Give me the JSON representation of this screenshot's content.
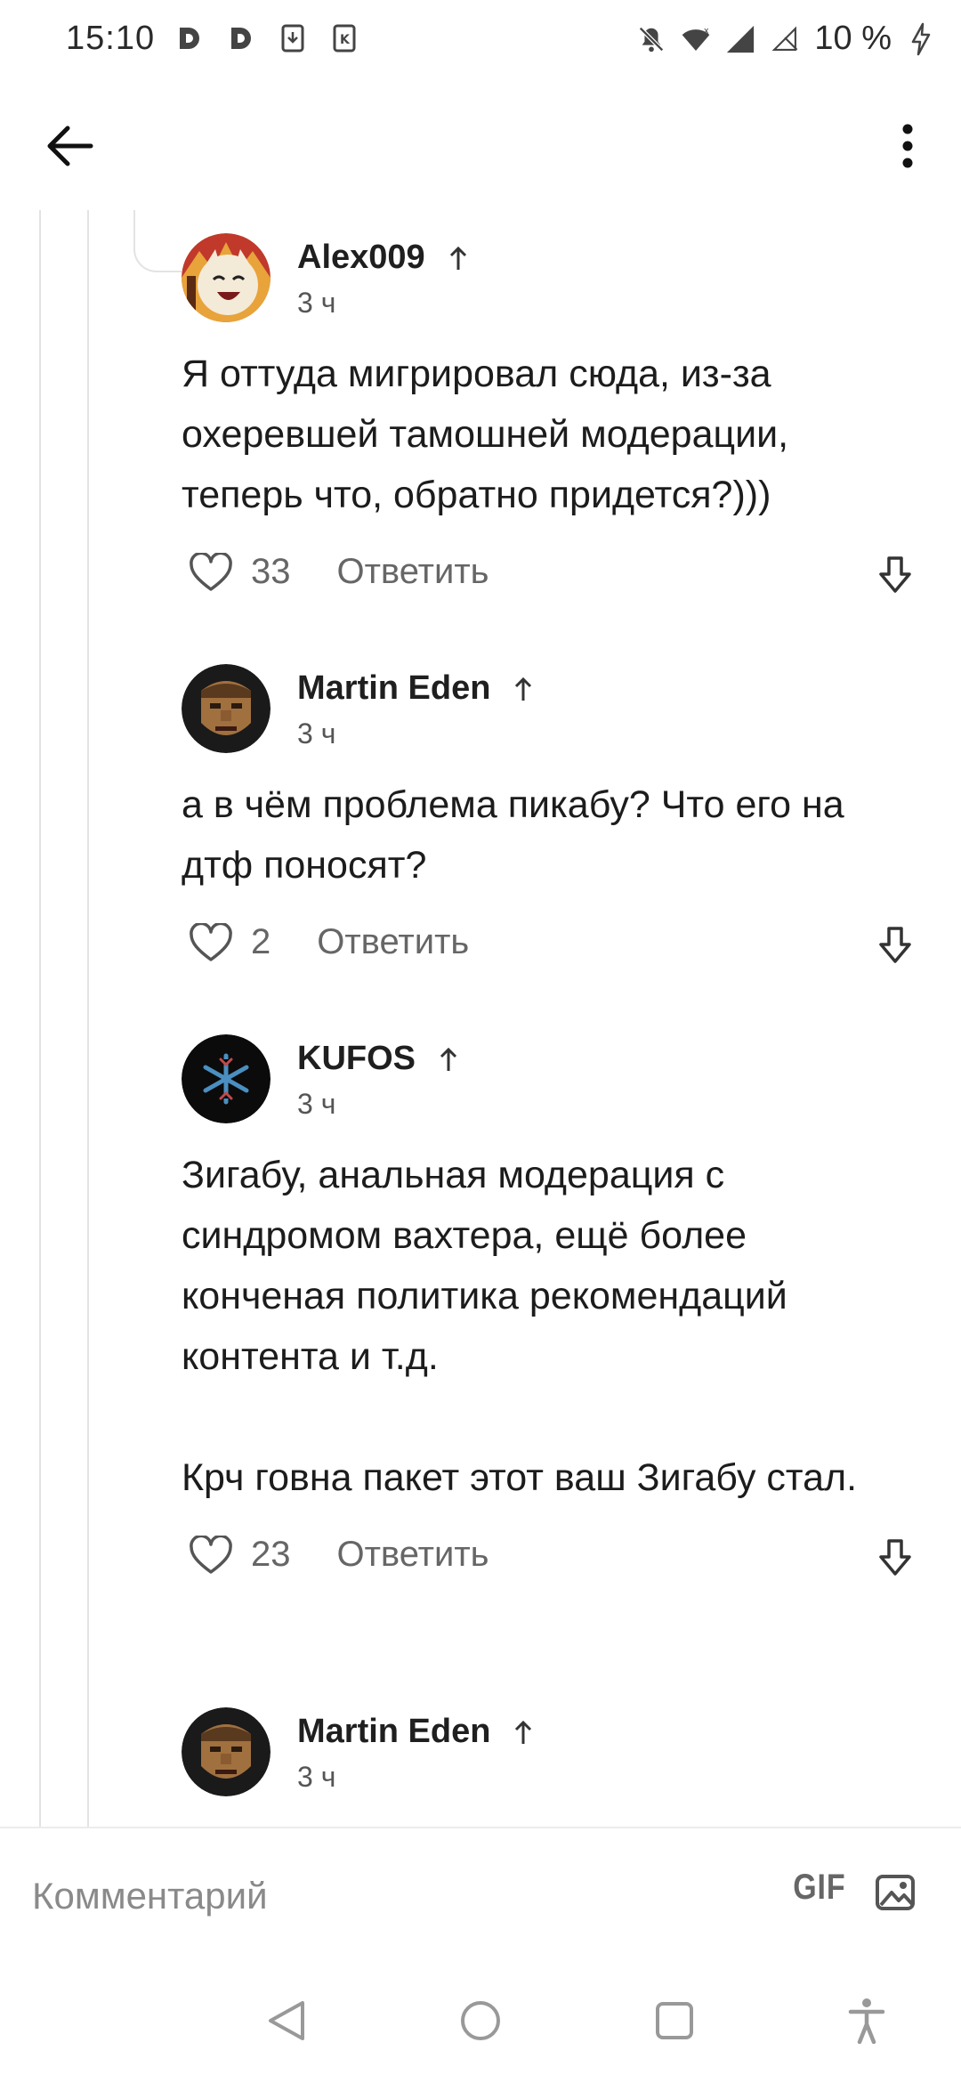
{
  "status_bar": {
    "time": "15:10",
    "notification_icons": [
      "d-app-icon",
      "d-app-icon",
      "download-icon",
      "k-app-icon"
    ],
    "system_icons": [
      "mute-icon",
      "wifi-icon",
      "signal-icon",
      "signal-empty-icon"
    ],
    "battery": "10 %"
  },
  "header": {
    "back_icon": "arrow-left-icon",
    "menu_icon": "more-vertical-icon"
  },
  "comments": [
    {
      "author": "Alex009",
      "time": "3 ч",
      "text": "Я оттуда мигрировал сюда, из-за охеревшей тамошней модерации, теперь что, обратно придется?)))",
      "likes": "33",
      "reply_label": "Ответить"
    },
    {
      "author": "Martin Eden",
      "time": "3 ч",
      "text": "а в чём проблема пикабу? Что его на дтф поносят?",
      "likes": "2",
      "reply_label": "Ответить"
    },
    {
      "author": "KUFOS",
      "time": "3 ч",
      "text": "Зигабу, анальная модерация с синдромом вахтера, ещё более конченая политика рекомендаций контента и т.д.\n\nКрч говна пакет этот ваш Зигабу стал.",
      "likes": "23",
      "reply_label": "Ответить"
    },
    {
      "author": "Martin Eden",
      "time": "3 ч"
    }
  ],
  "composer": {
    "placeholder": "Комментарий",
    "gif_label": "GIF",
    "image_icon": "image-icon"
  },
  "colors": {
    "text": "#1c1c1c",
    "secondary": "#666666",
    "divider": "#e3e3e3"
  }
}
